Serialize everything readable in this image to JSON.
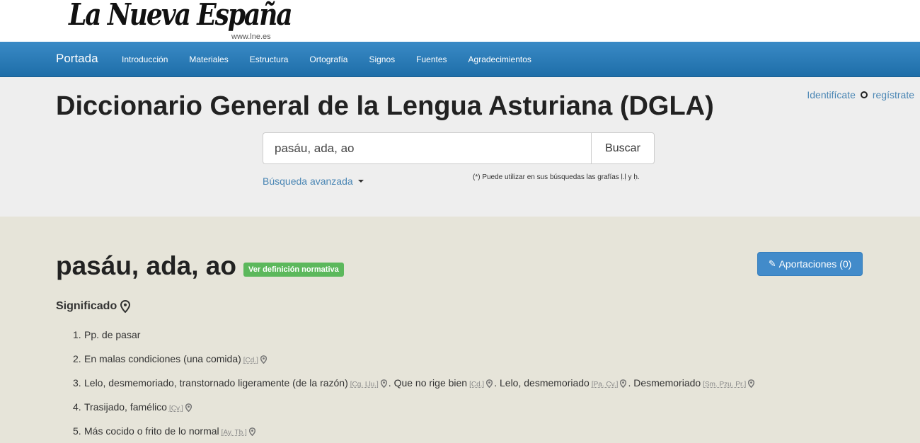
{
  "logo": {
    "title": "La Nueva España",
    "url": "www.lne.es"
  },
  "nav": {
    "brand": "Portada",
    "links": [
      "Introducción",
      "Materiales",
      "Estructura",
      "Ortografía",
      "Signos",
      "Fuentes",
      "Agradecimientos"
    ]
  },
  "login": {
    "identify": "Identifícate",
    "register": "regístrate"
  },
  "page_title": "Diccionario General de la Lengua Asturiana (DGLA)",
  "search": {
    "value": "pasáu, ada, ao",
    "button": "Buscar",
    "advanced": "Búsqueda avanzada",
    "hint": "(*) Puede utilizar en sus búsquedas las grafías ḷ.ḷ y ḥ."
  },
  "entry": {
    "headword": "pasáu, ada, ao",
    "normative_label": "Ver definición normativa",
    "contributions_button": "Aportaciones (0)",
    "section_title": "Significado",
    "definitions": [
      {
        "num": "1.",
        "segments": [
          {
            "text": "Pp. de pasar"
          }
        ]
      },
      {
        "num": "2.",
        "segments": [
          {
            "text": "En malas condiciones (una comida)",
            "source": "[Cd.]"
          }
        ]
      },
      {
        "num": "3.",
        "segments": [
          {
            "text": "Lelo, desmemoriado, transtornado ligeramente (de la razón)",
            "source": "[Cg. Llu.]"
          },
          {
            "text": ". Que no rige bien",
            "source": "[Cd.]"
          },
          {
            "text": ". Lelo, desmemoriado",
            "source": "[Pa. Cv.]"
          },
          {
            "text": ". Desmemoriado",
            "source": "[Sm. Pzu. Pr.]"
          }
        ]
      },
      {
        "num": "4.",
        "segments": [
          {
            "text": "Trasijado, famélico",
            "source": "[Cv.]"
          }
        ]
      },
      {
        "num": "5.",
        "segments": [
          {
            "text": "Más cocido o frito de lo normal",
            "source": "[Ay. Tb.]"
          }
        ]
      }
    ]
  },
  "colors": {
    "nav_blue": "#2a7bb7",
    "label_green": "#5cb85c",
    "button_blue": "#428bca",
    "link_blue": "#4a86b4",
    "content_bg": "#e6e4d9",
    "hero_bg": "#eeeeee"
  },
  "icons": [
    "map-marker-icon",
    "pencil-icon",
    "caret-down-icon",
    "circle-icon"
  ]
}
